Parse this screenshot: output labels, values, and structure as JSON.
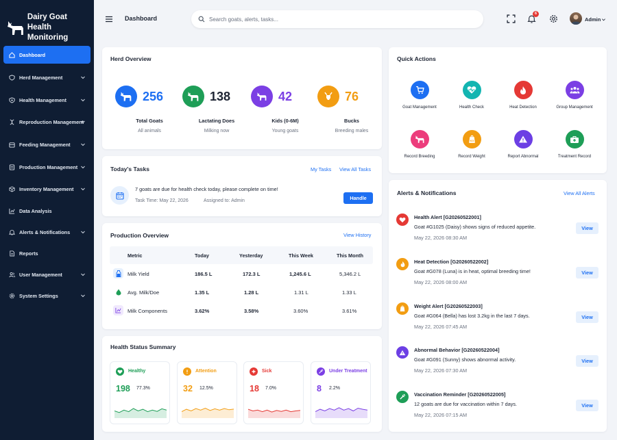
{
  "app": {
    "title_line1": "Dairy Goat",
    "title_line2": "Health Monitoring"
  },
  "sidebar": {
    "items": [
      {
        "label": "Dashboard",
        "icon": "home-icon",
        "active": true
      },
      {
        "label": "Herd Management",
        "icon": "shield-icon"
      },
      {
        "label": "Health Management",
        "icon": "shield-plus-icon"
      },
      {
        "label": "Reproduction Management",
        "icon": "dna-icon"
      },
      {
        "label": "Feeding Management",
        "icon": "feed-icon"
      },
      {
        "label": "Production Management",
        "icon": "factory-icon"
      },
      {
        "label": "Inventory Management",
        "icon": "box-icon"
      },
      {
        "label": "Data Analysis",
        "icon": "chart-icon"
      },
      {
        "label": "Alerts & Notifications",
        "icon": "bell-icon"
      },
      {
        "label": "Reports",
        "icon": "report-icon"
      },
      {
        "label": "User Management",
        "icon": "users-icon"
      },
      {
        "label": "System Settings",
        "icon": "gear-icon"
      }
    ]
  },
  "header": {
    "title": "Dashboard",
    "search_placeholder": "Search goats, alerts, tasks...",
    "notification_count": "6",
    "user": "Admin"
  },
  "herd": {
    "title": "Herd Overview",
    "stats": [
      {
        "value": "256",
        "label": "Total Goats",
        "sub": "All animals",
        "color": "#1d6ff2"
      },
      {
        "value": "138",
        "label": "Lactating Does",
        "sub": "Milking now",
        "color": "#1e9e57"
      },
      {
        "value": "42",
        "label": "Kids (0-6M)",
        "sub": "Young goats",
        "color": "#7b3fe4"
      },
      {
        "value": "76",
        "label": "Bucks",
        "sub": "Breeding males",
        "color": "#f29d12"
      }
    ]
  },
  "quick_actions": {
    "title": "Quick Actions",
    "items": [
      {
        "label": "Goat Management",
        "color": "#1d6ff2",
        "icon": "cart-icon"
      },
      {
        "label": "Health Check",
        "color": "#13b5b1",
        "icon": "heart-pulse-icon"
      },
      {
        "label": "Heat Detection",
        "color": "#e53935",
        "icon": "flame-icon"
      },
      {
        "label": "Group Management",
        "color": "#7b3fe4",
        "icon": "group-icon"
      },
      {
        "label": "Record Breeding",
        "color": "#ec3d7c",
        "icon": "goat-icon"
      },
      {
        "label": "Record Weight",
        "color": "#f29d12",
        "icon": "scale-icon"
      },
      {
        "label": "Report Abnormal",
        "color": "#6c3fe4",
        "icon": "warning-icon"
      },
      {
        "label": "Treatment Record",
        "color": "#1e9e57",
        "icon": "medkit-icon"
      }
    ]
  },
  "tasks": {
    "title": "Today's Tasks",
    "my_tasks": "My Tasks",
    "view_all": "View All Tasks",
    "text": "7 goats are due for health check today, please complete on time!",
    "task_time": "Task Time: May 22, 2026",
    "assigned": "Assigned to: Admin",
    "button": "Handle"
  },
  "production": {
    "title": "Production Overview",
    "view_history": "View History",
    "headers": [
      "Metric",
      "Today",
      "Yesterday",
      "This Week",
      "This Month"
    ],
    "rows": [
      {
        "metric": "Milk Yield",
        "today": "186.5 L",
        "yesterday": "172.3 L",
        "week": "1,245.6 L",
        "month": "5,346.2 L",
        "icon": "bottle-icon",
        "color": "#1d6ff2"
      },
      {
        "metric": "Avg. Milk/Doe",
        "today": "1.35 L",
        "yesterday": "1.28 L",
        "week": "1.31 L",
        "month": "1.33 L",
        "icon": "drop-icon",
        "color": "#1e9e57"
      },
      {
        "metric": "Milk Components",
        "today": "3.62%",
        "yesterday": "3.58%",
        "week": "3.60%",
        "month": "3.61%",
        "icon": "chart-icon",
        "color": "#7b3fe4"
      }
    ]
  },
  "health": {
    "title": "Health Status Summary",
    "cards": [
      {
        "name": "Healthy",
        "count": "198",
        "pct": "77.3%",
        "color": "#1e9e57",
        "icon": "heart-icon",
        "trend": [
          0.45,
          0.35,
          0.5,
          0.4,
          0.6,
          0.45,
          0.55,
          0.4,
          0.5,
          0.42,
          0.58,
          0.5
        ]
      },
      {
        "name": "Attention",
        "count": "32",
        "pct": "12.5%",
        "color": "#f29d12",
        "icon": "alert-icon",
        "trend": [
          0.4,
          0.55,
          0.45,
          0.6,
          0.5,
          0.62,
          0.48,
          0.58,
          0.5,
          0.6,
          0.52,
          0.56
        ]
      },
      {
        "name": "Sick",
        "count": "18",
        "pct": "7.0%",
        "color": "#e53935",
        "icon": "cross-icon",
        "trend": [
          0.55,
          0.45,
          0.5,
          0.4,
          0.5,
          0.38,
          0.48,
          0.42,
          0.5,
          0.4,
          0.45,
          0.48
        ]
      },
      {
        "name": "Under Treatment",
        "count": "8",
        "pct": "2.2%",
        "color": "#7b3fe4",
        "icon": "syringe-icon",
        "trend": [
          0.4,
          0.55,
          0.45,
          0.6,
          0.5,
          0.65,
          0.5,
          0.6,
          0.45,
          0.62,
          0.55,
          0.5
        ]
      }
    ]
  },
  "alerts": {
    "title": "Alerts & Notifications",
    "view_all": "View All Alerts",
    "view_label": "View",
    "items": [
      {
        "title": "Health Alert    [G20260522001]",
        "desc": "Goat #G1025 (Daisy) shows signs of reduced appetite.",
        "time": "May 22, 2026 08:30 AM",
        "color": "#e53935",
        "icon": "heart-icon"
      },
      {
        "title": "Heat Detection    [G20260522002]",
        "desc": "Goat #G078 (Luna) is in heat, optimal breeding time!",
        "time": "May 22, 2026 08:00 AM",
        "color": "#f29d12",
        "icon": "flame-icon"
      },
      {
        "title": "Weight Alert    [G20260522003]",
        "desc": "Goat #G064 (Bella) has lost 3.2kg in the last 7 days.",
        "time": "May 22, 2026 07:45 AM",
        "color": "#f29d12",
        "icon": "scale-icon"
      },
      {
        "title": "Abnormal Behavior    [G20260522004]",
        "desc": "Goat #G091 (Sunny) shows abnormal activity.",
        "time": "May 22, 2026 07:30 AM",
        "color": "#6c3fe4",
        "icon": "warning-icon"
      },
      {
        "title": "Vaccination Reminder    [G20260522005]",
        "desc": "12 goats are due for vaccination within 7 days.",
        "time": "May 22, 2026 07:15 AM",
        "color": "#1e9e57",
        "icon": "syringe-icon"
      }
    ]
  }
}
